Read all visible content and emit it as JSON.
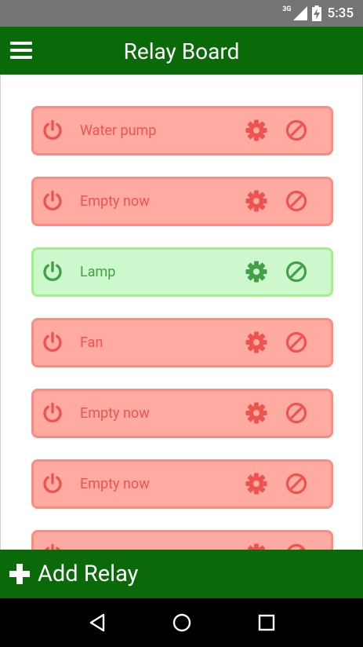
{
  "status_bar": {
    "network": "3G",
    "time": "5:35"
  },
  "app_bar": {
    "title": "Relay Board",
    "menu_icon": "hamburger-menu-icon"
  },
  "colors": {
    "primary": "#0a6a0a",
    "off_fill": "#ffaba2",
    "off_border": "#ff8a80",
    "off_icon": "#ef5350",
    "on_fill": "#cdf7cd",
    "on_border": "#a5ec8a",
    "on_icon": "#43a047"
  },
  "relays": [
    {
      "label": "Water pump",
      "state": "off"
    },
    {
      "label": "Empty now",
      "state": "off"
    },
    {
      "label": "Lamp",
      "state": "on"
    },
    {
      "label": "Fan",
      "state": "off"
    },
    {
      "label": "Empty now",
      "state": "off"
    },
    {
      "label": "Empty now",
      "state": "off"
    },
    {
      "label": "",
      "state": "off"
    }
  ],
  "add_button": {
    "label": "Add Relay",
    "icon": "plus-icon"
  },
  "nav": {
    "back_icon": "back-triangle-icon",
    "home_icon": "home-circle-icon",
    "recents_icon": "recents-square-icon"
  }
}
